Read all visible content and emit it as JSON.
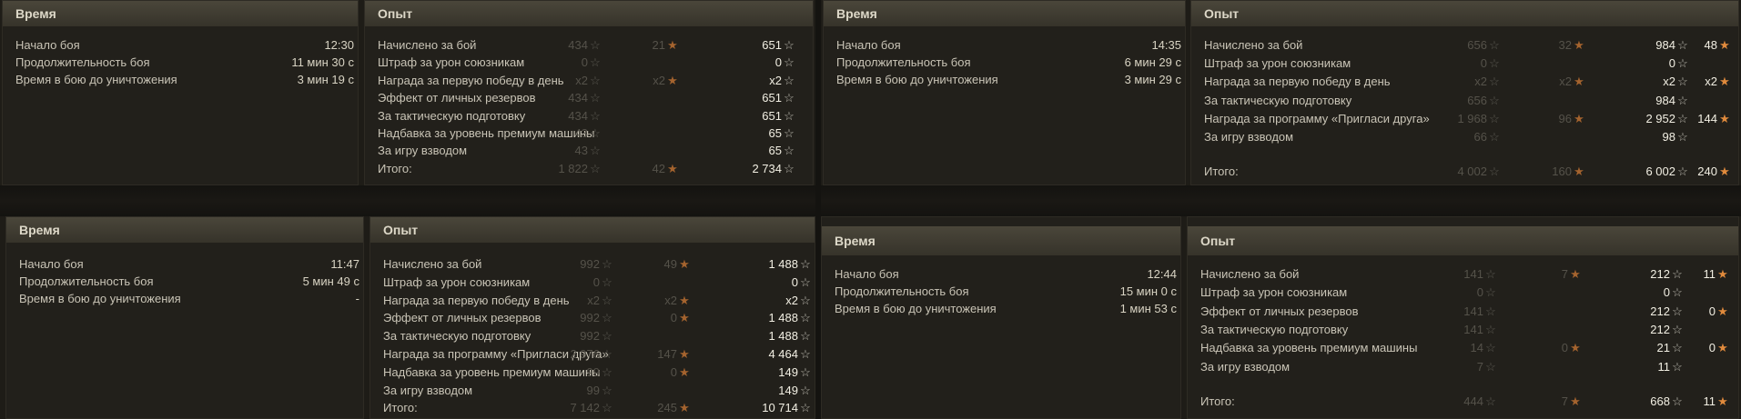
{
  "panels": [
    {
      "time_title": "Время",
      "xp_title": "Опыт",
      "time_rows": [
        {
          "label": "Начало боя",
          "value": "12:30"
        },
        {
          "label": "Продолжительность боя",
          "value": "11 мин 30 с"
        },
        {
          "label": "Время в бою до уничтожения",
          "value": "3 мин 19 с"
        }
      ],
      "xp_rows": [
        {
          "label": "Начислено за бой",
          "v1": "434",
          "v2": "21",
          "v3": "651",
          "v4": ""
        },
        {
          "label": "Штраф за урон союзникам",
          "v1": "0",
          "v2": "",
          "v3": "0",
          "v4": ""
        },
        {
          "label": "Награда за первую победу в день",
          "v1": "x2",
          "v2": "x2",
          "v3": "x2",
          "v4": ""
        },
        {
          "label": "Эффект от личных резервов",
          "v1": "434",
          "v2": "",
          "v3": "651",
          "v4": ""
        },
        {
          "label": "За тактическую подготовку",
          "v1": "434",
          "v2": "",
          "v3": "651",
          "v4": ""
        },
        {
          "label": "Надбавка за уровень премиум машины",
          "v1": "43",
          "v2": "",
          "v3": "65",
          "v4": ""
        },
        {
          "label": "За игру взводом",
          "v1": "43",
          "v2": "",
          "v3": "65",
          "v4": ""
        },
        {
          "label": "Итого:",
          "v1": "1 822",
          "v2": "42",
          "v3": "2 734",
          "v4": ""
        }
      ]
    },
    {
      "time_title": "Время",
      "xp_title": "Опыт",
      "time_rows": [
        {
          "label": "Начало боя",
          "value": "14:35"
        },
        {
          "label": "Продолжительность боя",
          "value": "6 мин 29 с"
        },
        {
          "label": "Время в бою до уничтожения",
          "value": "3 мин 29 с"
        }
      ],
      "xp_rows": [
        {
          "label": "Начислено за бой",
          "v1": "656",
          "v2": "32",
          "v3": "984",
          "v4": "48"
        },
        {
          "label": "Штраф за урон союзникам",
          "v1": "0",
          "v2": "",
          "v3": "0",
          "v4": ""
        },
        {
          "label": "Награда за первую победу в день",
          "v1": "x2",
          "v2": "x2",
          "v3": "x2",
          "v4": "x2"
        },
        {
          "label": "За тактическую подготовку",
          "v1": "656",
          "v2": "",
          "v3": "984",
          "v4": ""
        },
        {
          "label": "Награда за программу «Пригласи друга»",
          "v1": "1 968",
          "v2": "96",
          "v3": "2 952",
          "v4": "144"
        },
        {
          "label": "За игру взводом",
          "v1": "66",
          "v2": "",
          "v3": "98",
          "v4": ""
        },
        {
          "label": "Итого:",
          "v1": "4 002",
          "v2": "160",
          "v3": "6 002",
          "v4": "240"
        }
      ]
    },
    {
      "time_title": "Время",
      "xp_title": "Опыт",
      "time_rows": [
        {
          "label": "Начало боя",
          "value": "11:47"
        },
        {
          "label": "Продолжительность боя",
          "value": "5 мин 49 с"
        },
        {
          "label": "Время в бою до уничтожения",
          "value": "-"
        }
      ],
      "xp_rows": [
        {
          "label": "Начислено за бой",
          "v1": "992",
          "v2": "49",
          "v3": "1 488",
          "v4": ""
        },
        {
          "label": "Штраф за урон союзникам",
          "v1": "0",
          "v2": "",
          "v3": "0",
          "v4": ""
        },
        {
          "label": "Награда за первую победу в день",
          "v1": "x2",
          "v2": "x2",
          "v3": "x2",
          "v4": ""
        },
        {
          "label": "Эффект от личных резервов",
          "v1": "992",
          "v2": "0",
          "v3": "1 488",
          "v4": ""
        },
        {
          "label": "За тактическую подготовку",
          "v1": "992",
          "v2": "",
          "v3": "1 488",
          "v4": ""
        },
        {
          "label": "Награда за программу «Пригласи друга»",
          "v1": "2 976",
          "v2": "147",
          "v3": "4 464",
          "v4": ""
        },
        {
          "label": "Надбавка за уровень премиум машины",
          "v1": "99",
          "v2": "0",
          "v3": "149",
          "v4": ""
        },
        {
          "label": "За игру взводом",
          "v1": "99",
          "v2": "",
          "v3": "149",
          "v4": ""
        },
        {
          "label": "Итого:",
          "v1": "7 142",
          "v2": "245",
          "v3": "10 714",
          "v4": ""
        }
      ]
    },
    {
      "time_title": "Время",
      "xp_title": "Опыт",
      "time_rows": [
        {
          "label": "Начало боя",
          "value": "12:44"
        },
        {
          "label": "Продолжительность боя",
          "value": "15 мин 0 с"
        },
        {
          "label": "Время в бою до уничтожения",
          "value": "1 мин 53 с"
        }
      ],
      "xp_rows": [
        {
          "label": "Начислено за бой",
          "v1": "141",
          "v2": "7",
          "v3": "212",
          "v4": "11"
        },
        {
          "label": "Штраф за урон союзникам",
          "v1": "0",
          "v2": "",
          "v3": "0",
          "v4": ""
        },
        {
          "label": "Эффект от личных резервов",
          "v1": "141",
          "v2": "",
          "v3": "212",
          "v4": "0"
        },
        {
          "label": "За тактическую подготовку",
          "v1": "141",
          "v2": "",
          "v3": "212",
          "v4": ""
        },
        {
          "label": "Надбавка за уровень премиум машины",
          "v1": "14",
          "v2": "0",
          "v3": "21",
          "v4": "0"
        },
        {
          "label": "За игру взводом",
          "v1": "7",
          "v2": "",
          "v3": "11",
          "v4": ""
        },
        {
          "label": "Итого:",
          "v1": "444",
          "v2": "7",
          "v3": "668",
          "v4": "11"
        }
      ]
    }
  ]
}
